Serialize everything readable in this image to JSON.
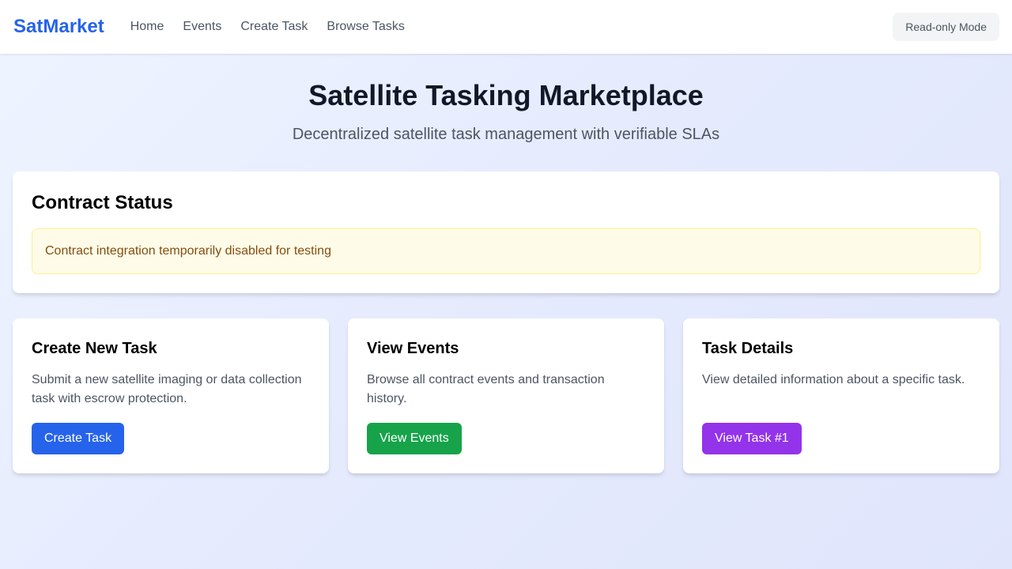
{
  "nav": {
    "brand": "SatMarket",
    "links": [
      "Home",
      "Events",
      "Create Task",
      "Browse Tasks"
    ],
    "mode_badge": "Read-only Mode"
  },
  "hero": {
    "title": "Satellite Tasking Marketplace",
    "subtitle": "Decentralized satellite task management with verifiable SLAs"
  },
  "status": {
    "title": "Contract Status",
    "alert": "Contract integration temporarily disabled for testing"
  },
  "cards": [
    {
      "title": "Create New Task",
      "description": "Submit a new satellite imaging or data collection task with escrow protection.",
      "button": "Create Task",
      "button_color": "#2563eb"
    },
    {
      "title": "View Events",
      "description": "Browse all contract events and transaction history.",
      "button": "View Events",
      "button_color": "#16a34a"
    },
    {
      "title": "Task Details",
      "description": "View detailed information about a specific task.",
      "button": "View Task #1",
      "button_color": "#9333ea"
    }
  ],
  "colors": {
    "brand": "#2563eb",
    "alert_bg": "#fefce8",
    "alert_text": "#854d0e"
  }
}
